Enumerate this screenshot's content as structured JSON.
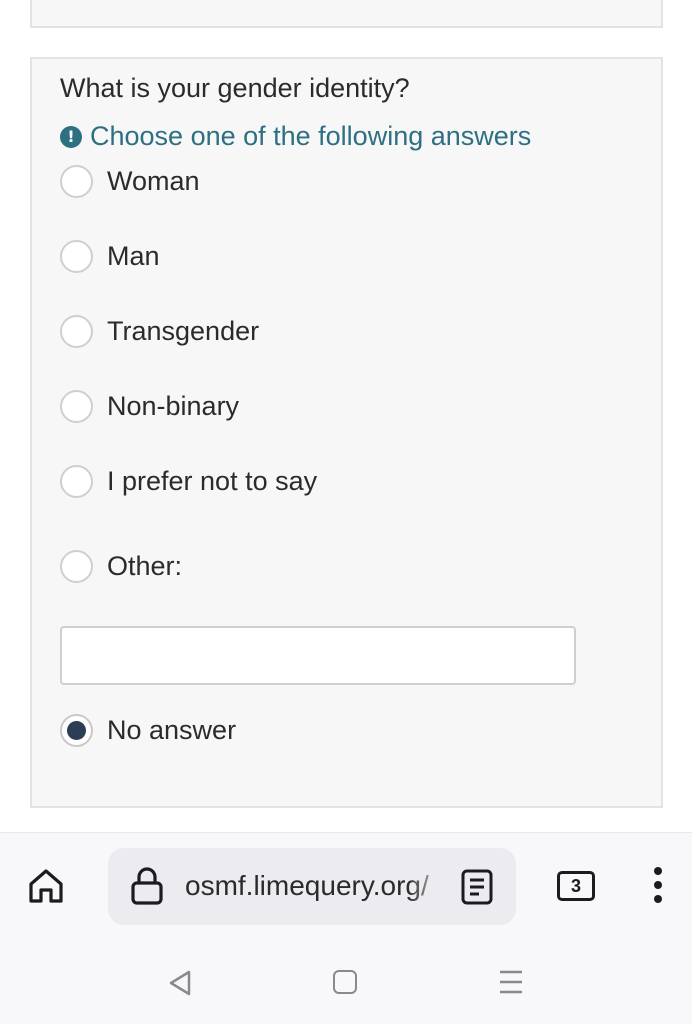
{
  "question": {
    "title": "What is your gender identity?",
    "hint": "Choose one of the following answers",
    "hint_icon": "!"
  },
  "options": [
    {
      "label": "Woman",
      "checked": false
    },
    {
      "label": "Man",
      "checked": false
    },
    {
      "label": "Transgender",
      "checked": false
    },
    {
      "label": "Non-binary",
      "checked": false
    },
    {
      "label": "I prefer not to say",
      "checked": false
    },
    {
      "label": "Other:",
      "checked": false
    },
    {
      "label": "No answer",
      "checked": true
    }
  ],
  "other_input": {
    "value": ""
  },
  "browser": {
    "url": "osmf.limequery.org/",
    "tab_count": "3"
  },
  "colors": {
    "hint": "#2e6f82",
    "radio_selected": "#2c3e55",
    "card_bg": "#f7f7f7"
  },
  "icons": [
    "info-icon",
    "home-icon",
    "lock-icon",
    "reader-mode-icon",
    "tabs-icon",
    "more-menu-icon",
    "nav-back-icon",
    "nav-home-icon",
    "nav-recents-icon"
  ]
}
